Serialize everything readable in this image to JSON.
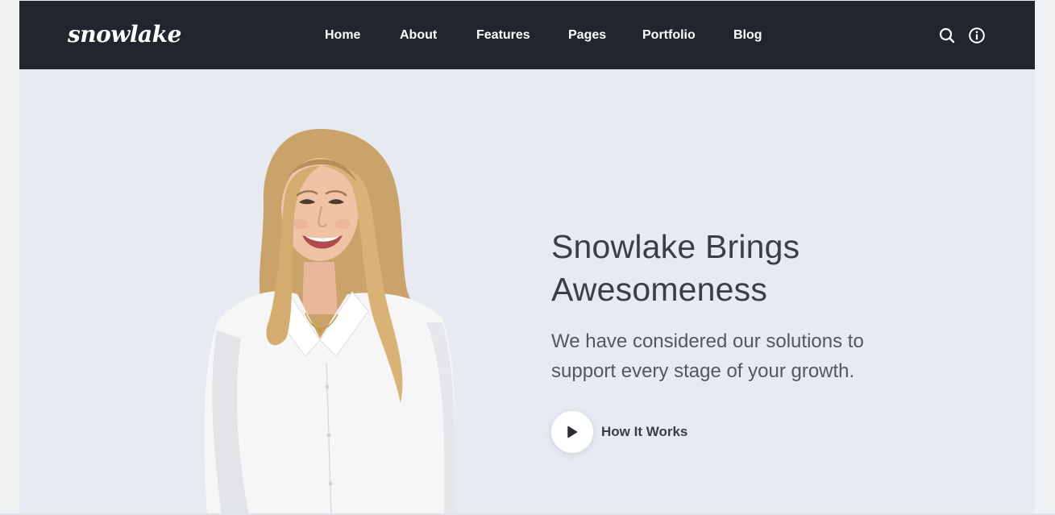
{
  "brand": {
    "logo_text": "snowlake"
  },
  "nav": {
    "items": [
      {
        "label": "Home"
      },
      {
        "label": "About"
      },
      {
        "label": "Features"
      },
      {
        "label": "Pages"
      },
      {
        "label": "Portfolio"
      },
      {
        "label": "Blog"
      }
    ],
    "icons": {
      "search": "search-icon",
      "info": "info-icon"
    }
  },
  "hero": {
    "title_line1": "Snowlake Brings",
    "title_line2": "Awesomeness",
    "subtitle_line1": "We have considered our solutions to",
    "subtitle_line2": "support every stage of your growth.",
    "cta_label": "How It Works",
    "cta_icon": "play-icon"
  },
  "colors": {
    "navbar_bg": "#21262e",
    "hero_bg": "#e7eaf1",
    "heading": "#3b3f45",
    "text": "#53575e"
  }
}
